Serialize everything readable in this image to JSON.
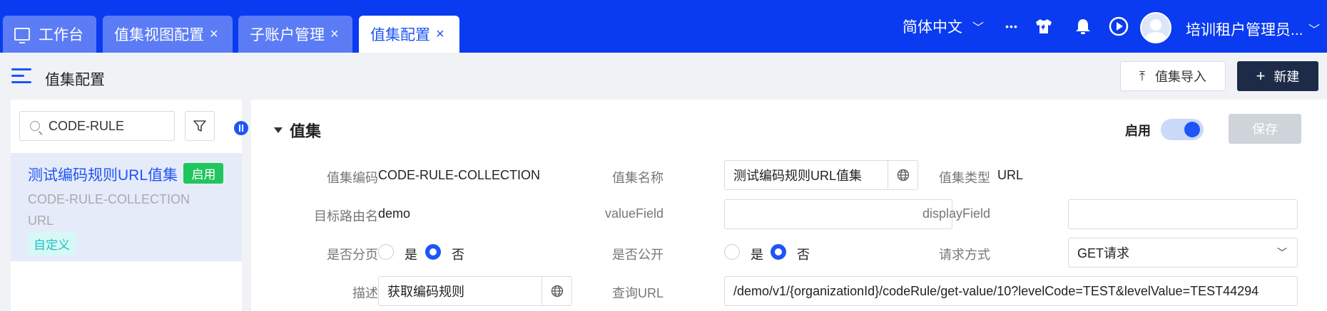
{
  "colors": {
    "primary": "#1f55f5",
    "topbar": "#0a3bf0",
    "success": "#21c55d",
    "dark_button": "#1d2b49"
  },
  "tabs": [
    {
      "label": "工作台",
      "icon": "monitor-icon",
      "closable": false,
      "active": false
    },
    {
      "label": "值集视图配置",
      "closable": true,
      "active": false
    },
    {
      "label": "子账户管理",
      "closable": true,
      "active": false
    },
    {
      "label": "值集配置",
      "closable": true,
      "active": true
    }
  ],
  "topbar": {
    "language": "简体中文",
    "more": "•••",
    "icons": [
      "skin-icon",
      "bell-icon",
      "play-icon"
    ],
    "user_name": "培训租户管理员..."
  },
  "header": {
    "title": "值集配置",
    "import_label": "值集导入",
    "new_label": "新建"
  },
  "sidebar": {
    "search_value": "CODE-RULE",
    "items": [
      {
        "name": "测试编码规则URL值集",
        "status": "启用",
        "code": "CODE-RULE-COLLECTION",
        "type": "URL",
        "tag": "自定义"
      }
    ]
  },
  "detail": {
    "section_title": "值集",
    "enable_label": "启用",
    "enabled": true,
    "save_label": "保存",
    "fields": {
      "code_label": "值集编码",
      "code_value": "CODE-RULE-COLLECTION",
      "name_label": "值集名称",
      "name_value": "测试编码规则URL值集",
      "type_label": "值集类型",
      "type_value": "URL",
      "route_label": "目标路由名",
      "route_value": "demo",
      "value_field_label": "valueField",
      "value_field_value": "",
      "display_field_label": "displayField",
      "display_field_value": "",
      "paging_label": "是否分页",
      "paging_yes": "是",
      "paging_no": "否",
      "paging_selected": "否",
      "public_label": "是否公开",
      "public_yes": "是",
      "public_no": "否",
      "public_selected": "否",
      "method_label": "请求方式",
      "method_value": "GET请求",
      "desc_label": "描述",
      "desc_value": "获取编码规则",
      "url_label": "查询URL",
      "url_value": "/demo/v1/{organizationId}/codeRule/get-value/10?levelCode=TEST&levelValue=TEST44294"
    }
  }
}
